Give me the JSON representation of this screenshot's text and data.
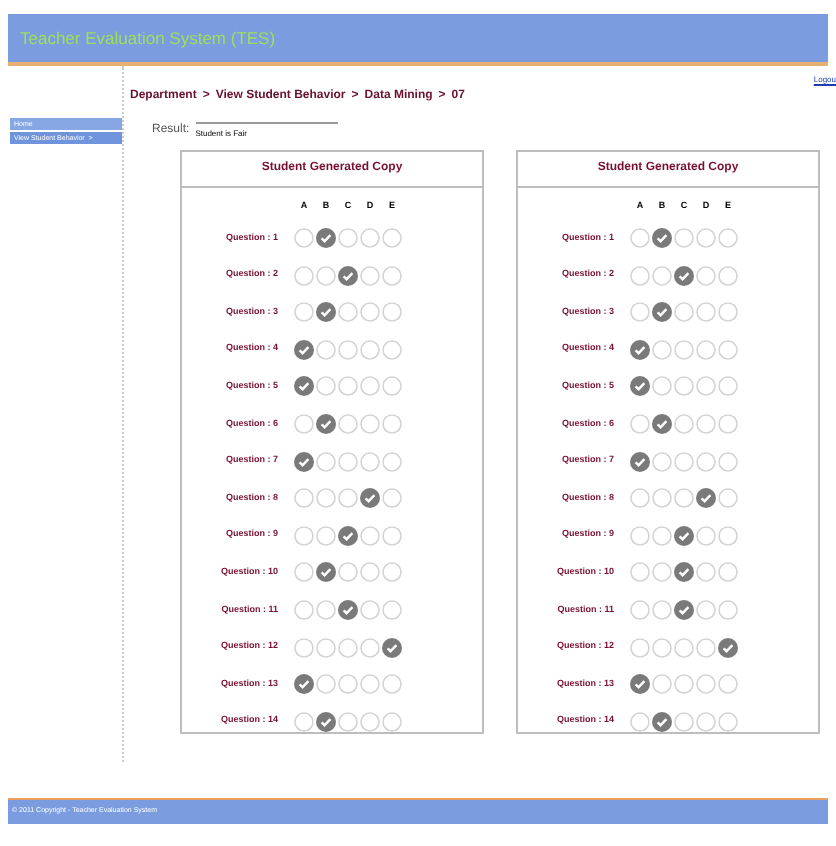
{
  "header": {
    "title": "Teacher Evaluation System (TES)",
    "link": "Logou"
  },
  "sidebar": {
    "items": [
      {
        "label": "Home",
        "selected": false
      },
      {
        "label": "View Student Behavior  >",
        "selected": true
      }
    ]
  },
  "breadcrumb": [
    "Department",
    ">",
    "View Student Behavior",
    ">",
    "Data Mining",
    ">",
    "07"
  ],
  "result": {
    "label": "Result:",
    "value": "Student is Fair"
  },
  "panels": [
    {
      "title": "Student Generated Copy",
      "choices": [
        "A",
        "B",
        "C",
        "D",
        "E"
      ],
      "questions": [
        {
          "label": "Question : 1",
          "options": [
            {
              "selected": false
            },
            {
              "selected": true
            },
            {
              "selected": false
            },
            {
              "selected": false
            },
            {
              "selected": false
            }
          ]
        },
        {
          "label": "Question : 2",
          "options": [
            {
              "selected": false
            },
            {
              "selected": false
            },
            {
              "selected": true
            },
            {
              "selected": false
            },
            {
              "selected": false
            }
          ]
        },
        {
          "label": "Question : 3",
          "options": [
            {
              "selected": false
            },
            {
              "selected": true
            },
            {
              "selected": false
            },
            {
              "selected": false
            },
            {
              "selected": false
            }
          ]
        },
        {
          "label": "Question : 4",
          "options": [
            {
              "selected": true
            },
            {
              "selected": false
            },
            {
              "selected": false
            },
            {
              "selected": false
            },
            {
              "selected": false
            }
          ]
        },
        {
          "label": "Question : 5",
          "options": [
            {
              "selected": true
            },
            {
              "selected": false
            },
            {
              "selected": false
            },
            {
              "selected": false
            },
            {
              "selected": false
            }
          ]
        },
        {
          "label": "Question : 6",
          "options": [
            {
              "selected": false
            },
            {
              "selected": true
            },
            {
              "selected": false
            },
            {
              "selected": false
            },
            {
              "selected": false
            }
          ]
        },
        {
          "label": "Question : 7",
          "options": [
            {
              "selected": true
            },
            {
              "selected": false
            },
            {
              "selected": false
            },
            {
              "selected": false
            },
            {
              "selected": false
            }
          ]
        },
        {
          "label": "Question : 8",
          "options": [
            {
              "selected": false
            },
            {
              "selected": false
            },
            {
              "selected": false
            },
            {
              "selected": true
            },
            {
              "selected": false
            }
          ]
        },
        {
          "label": "Question : 9",
          "options": [
            {
              "selected": false
            },
            {
              "selected": false
            },
            {
              "selected": true
            },
            {
              "selected": false
            },
            {
              "selected": false
            }
          ]
        },
        {
          "label": "Question : 10",
          "options": [
            {
              "selected": false
            },
            {
              "selected": true
            },
            {
              "selected": false
            },
            {
              "selected": false
            },
            {
              "selected": false
            }
          ]
        },
        {
          "label": "Question : 11",
          "options": [
            {
              "selected": false
            },
            {
              "selected": false
            },
            {
              "selected": true
            },
            {
              "selected": false
            },
            {
              "selected": false
            }
          ]
        },
        {
          "label": "Question : 12",
          "options": [
            {
              "selected": false
            },
            {
              "selected": false
            },
            {
              "selected": false
            },
            {
              "selected": false
            },
            {
              "selected": true
            }
          ]
        },
        {
          "label": "Question : 13",
          "options": [
            {
              "selected": true
            },
            {
              "selected": false
            },
            {
              "selected": false
            },
            {
              "selected": false
            },
            {
              "selected": false
            }
          ]
        },
        {
          "label": "Question : 14",
          "options": [
            {
              "selected": false
            },
            {
              "selected": true
            },
            {
              "selected": false
            },
            {
              "selected": false
            },
            {
              "selected": false
            }
          ]
        }
      ]
    },
    {
      "title": "Student Generated Copy",
      "choices": [
        "A",
        "B",
        "C",
        "D",
        "E"
      ],
      "questions": [
        {
          "label": "Question : 1",
          "options": [
            {
              "selected": false
            },
            {
              "selected": true
            },
            {
              "selected": false
            },
            {
              "selected": false
            },
            {
              "selected": false
            }
          ]
        },
        {
          "label": "Question : 2",
          "options": [
            {
              "selected": false
            },
            {
              "selected": false
            },
            {
              "selected": true
            },
            {
              "selected": false
            },
            {
              "selected": false
            }
          ]
        },
        {
          "label": "Question : 3",
          "options": [
            {
              "selected": false
            },
            {
              "selected": true
            },
            {
              "selected": false
            },
            {
              "selected": false
            },
            {
              "selected": false
            }
          ]
        },
        {
          "label": "Question : 4",
          "options": [
            {
              "selected": true
            },
            {
              "selected": false
            },
            {
              "selected": false
            },
            {
              "selected": false
            },
            {
              "selected": false
            }
          ]
        },
        {
          "label": "Question : 5",
          "options": [
            {
              "selected": true
            },
            {
              "selected": false
            },
            {
              "selected": false
            },
            {
              "selected": false
            },
            {
              "selected": false
            }
          ]
        },
        {
          "label": "Question : 6",
          "options": [
            {
              "selected": false
            },
            {
              "selected": true
            },
            {
              "selected": false
            },
            {
              "selected": false
            },
            {
              "selected": false
            }
          ]
        },
        {
          "label": "Question : 7",
          "options": [
            {
              "selected": true
            },
            {
              "selected": false
            },
            {
              "selected": false
            },
            {
              "selected": false
            },
            {
              "selected": false
            }
          ]
        },
        {
          "label": "Question : 8",
          "options": [
            {
              "selected": false
            },
            {
              "selected": false
            },
            {
              "selected": false
            },
            {
              "selected": true
            },
            {
              "selected": false
            }
          ]
        },
        {
          "label": "Question : 9",
          "options": [
            {
              "selected": false
            },
            {
              "selected": false
            },
            {
              "selected": true
            },
            {
              "selected": false
            },
            {
              "selected": false
            }
          ]
        },
        {
          "label": "Question : 10",
          "options": [
            {
              "selected": false
            },
            {
              "selected": false
            },
            {
              "selected": true
            },
            {
              "selected": false
            },
            {
              "selected": false
            }
          ]
        },
        {
          "label": "Question : 11",
          "options": [
            {
              "selected": false
            },
            {
              "selected": false
            },
            {
              "selected": true
            },
            {
              "selected": false
            },
            {
              "selected": false
            }
          ]
        },
        {
          "label": "Question : 12",
          "options": [
            {
              "selected": false
            },
            {
              "selected": false
            },
            {
              "selected": false
            },
            {
              "selected": false
            },
            {
              "selected": true
            }
          ]
        },
        {
          "label": "Question : 13",
          "options": [
            {
              "selected": true
            },
            {
              "selected": false
            },
            {
              "selected": false
            },
            {
              "selected": false
            },
            {
              "selected": false
            }
          ]
        },
        {
          "label": "Question : 14",
          "options": [
            {
              "selected": false
            },
            {
              "selected": true
            },
            {
              "selected": false
            },
            {
              "selected": false
            },
            {
              "selected": false
            }
          ]
        }
      ]
    }
  ],
  "footer": "© 2011 Copyright - Teacher Evaluation System"
}
